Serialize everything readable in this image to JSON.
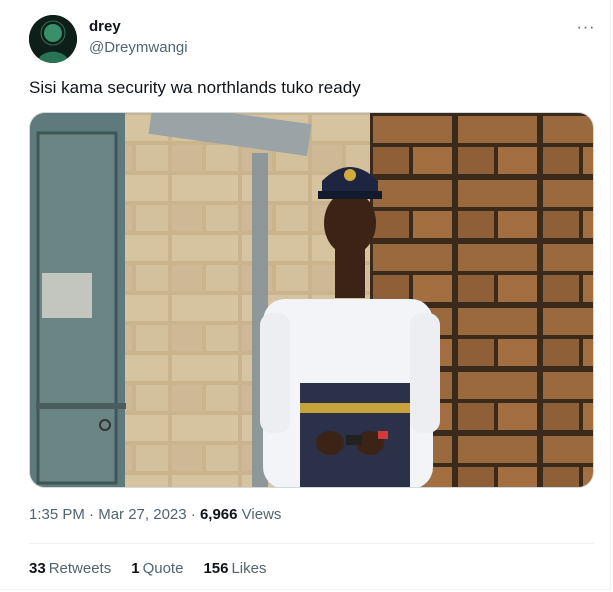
{
  "author": {
    "display_name": "drey",
    "handle": "@Dreymwangi",
    "avatar_icon": "profile-avatar"
  },
  "menu": {
    "more_icon": "more-horizontal-icon",
    "more_label": "···"
  },
  "tweet": {
    "text": "Sisi kama security wa northlands tuko ready",
    "media_description_icon": "attached-photo"
  },
  "meta": {
    "time": "1:35 PM",
    "separator": "·",
    "date": "Mar 27, 2023",
    "views_count": "6,966",
    "views_label": "Views"
  },
  "stats": {
    "retweets": {
      "count": "33",
      "label": "Retweets"
    },
    "quotes": {
      "count": "1",
      "label": "Quote"
    },
    "likes": {
      "count": "156",
      "label": "Likes"
    }
  },
  "colors": {
    "text_primary": "#0f1419",
    "text_secondary": "#536471",
    "border": "#eff3f4"
  }
}
